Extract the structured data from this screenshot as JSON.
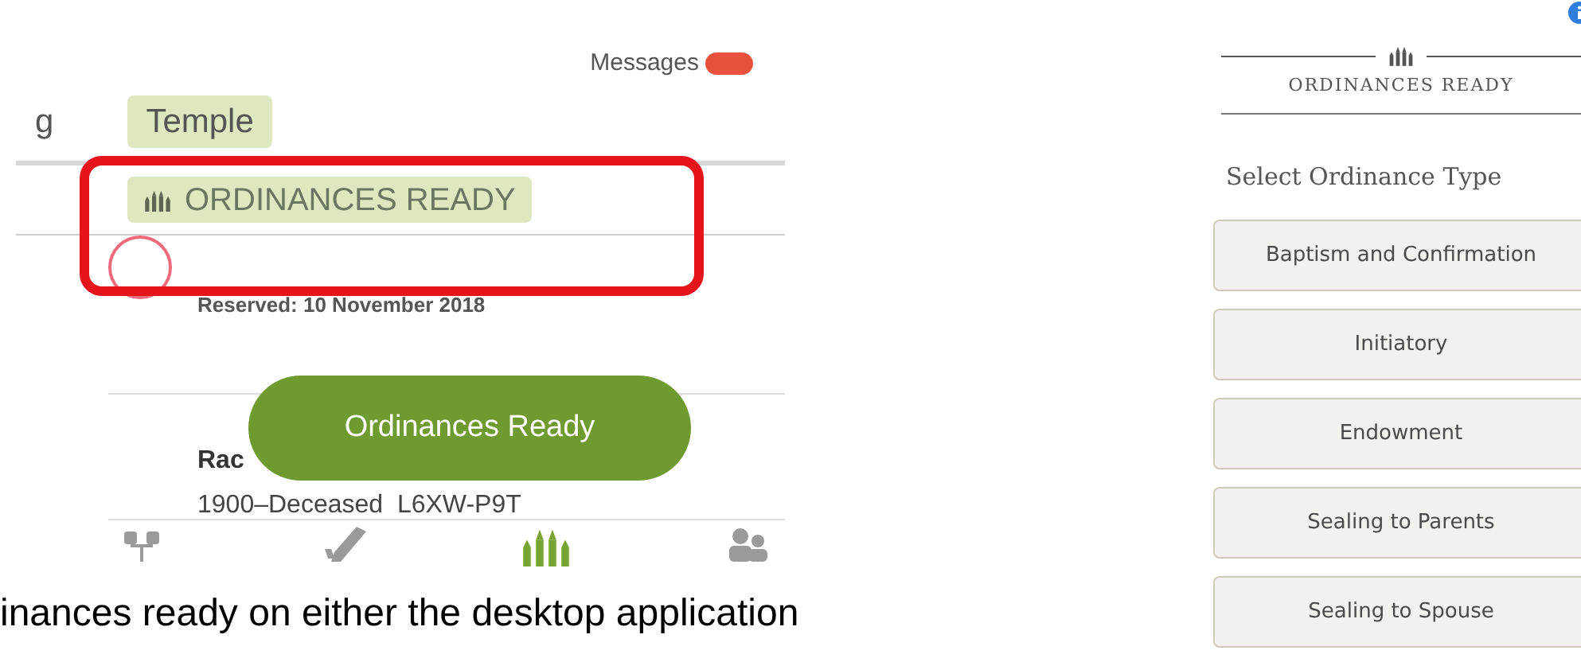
{
  "mobile_app": {
    "messages": {
      "label": "Messages"
    },
    "nav": [
      {
        "label": "g",
        "selected": false
      },
      {
        "label": "Temple",
        "selected": true
      }
    ],
    "status_badge": "ORDINANCES READY",
    "persons": [
      {
        "reserved": "Reserved: 10 November 2018"
      },
      {
        "name": "Rac",
        "life": "1900–Deceased",
        "pid": "L6XW-P9T"
      }
    ],
    "floating_button": "Ordinances Ready",
    "bottom_tabs": [
      {
        "kind": "tree",
        "selected": false
      },
      {
        "kind": "check",
        "selected": false
      },
      {
        "kind": "temple",
        "selected": true
      },
      {
        "kind": "people",
        "selected": false
      }
    ]
  },
  "caption": "inances ready on either the desktop application",
  "desktop_panel": {
    "section_title": "ORDINANCES READY",
    "prompt": "Select Ordinance Type",
    "ordinance_buttons": [
      "Baptism and Confirmation",
      "Initiatory",
      "Endowment",
      "Sealing to Parents",
      "Sealing to Spouse"
    ]
  }
}
